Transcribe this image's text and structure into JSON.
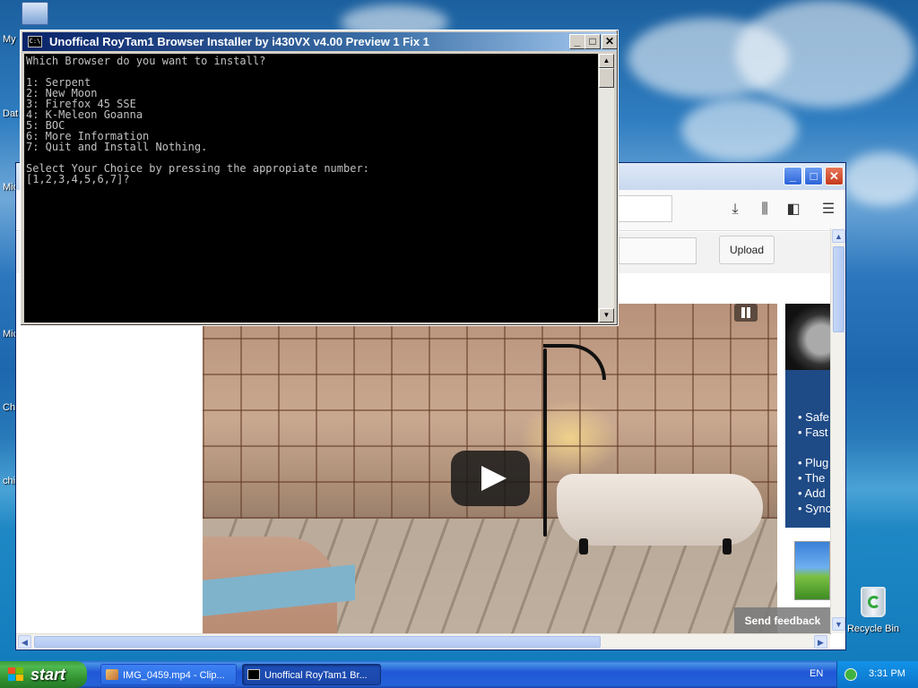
{
  "desktop": {
    "left_labels": [
      "My",
      "Dat",
      "Mic",
      "Mic",
      "Chi",
      "chi"
    ],
    "recycle_bin_label": "Recycle Bin"
  },
  "console": {
    "title": "Unoffical RoyTam1 Browser Installer by i430VX v4.00 Preview 1 Fix 1",
    "icon_text": "C:\\",
    "buttons": {
      "minimize": "_",
      "maximize": "□",
      "close": "✕"
    },
    "lines": [
      "Which Browser do you want to install?",
      "",
      "1: Serpent",
      "2: New Moon",
      "3: Firefox 45 SSE",
      "4: K-Meleon Goanna",
      "5: BOC",
      "6: More Information",
      "7: Quit and Install Nothing.",
      "",
      "Select Your Choice by pressing the appropiate number:",
      "[1,2,3,4,5,6,7]?"
    ]
  },
  "browser": {
    "window_buttons": {
      "minimize": "_",
      "maximize": "□",
      "close": "✕"
    },
    "toolbar_icons": [
      "download-icon",
      "library-icon",
      "sidebar-icon",
      "menu-icon"
    ],
    "upload_label": "Upload",
    "send_feedback": "Send feedback",
    "ad_items": [
      "• Safe",
      "• Fast",
      "",
      "• Plug",
      "• The",
      "• Add",
      "• Sync"
    ]
  },
  "taskbar": {
    "start_label": "start",
    "tasks": [
      {
        "label": "IMG_0459.mp4 - Clip...",
        "active": false
      },
      {
        "label": "Unoffical RoyTam1 Br...",
        "active": true
      }
    ],
    "language": "EN",
    "clock": "3:31 PM"
  },
  "colors": {
    "console_title_start": "#0a246a",
    "taskbar_blue": "#2157d7",
    "start_green": "#3c9a3c"
  }
}
